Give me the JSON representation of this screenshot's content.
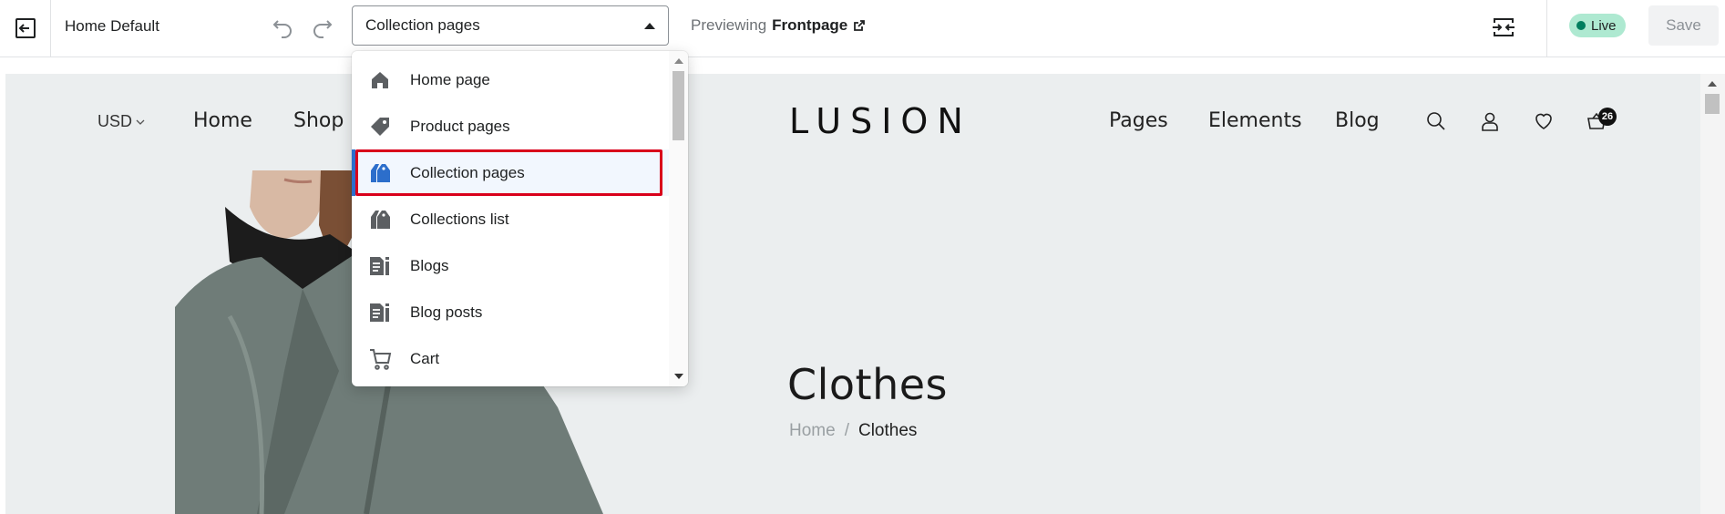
{
  "topbar": {
    "theme_name": "Home Default",
    "page_select_value": "Collection pages",
    "previewing_label": "Previewing",
    "previewing_target": "Frontpage",
    "status_badge": "Live",
    "save_label": "Save"
  },
  "dropdown": {
    "items": [
      {
        "label": "Home page",
        "icon": "home-icon"
      },
      {
        "label": "Product pages",
        "icon": "tag-icon"
      },
      {
        "label": "Collection pages",
        "icon": "collection-icon",
        "selected": true
      },
      {
        "label": "Collections list",
        "icon": "collection-icon"
      },
      {
        "label": "Blogs",
        "icon": "blog-icon"
      },
      {
        "label": "Blog posts",
        "icon": "blog-icon"
      },
      {
        "label": "Cart",
        "icon": "cart-icon"
      }
    ]
  },
  "store": {
    "currency": "USD",
    "nav_left": [
      "Home",
      "Shop"
    ],
    "logo": "LUSION",
    "nav_right": [
      "Pages",
      "Elements",
      "Blog"
    ],
    "cart_count": "26",
    "hero_title": "Clothes",
    "breadcrumb_home": "Home",
    "breadcrumb_sep": "/",
    "breadcrumb_current": "Clothes"
  },
  "colors": {
    "accent": "#2c6ecb",
    "highlight_border": "#d9001b",
    "live_badge_bg": "#aee9d1",
    "preview_bg": "#ebeeef"
  }
}
